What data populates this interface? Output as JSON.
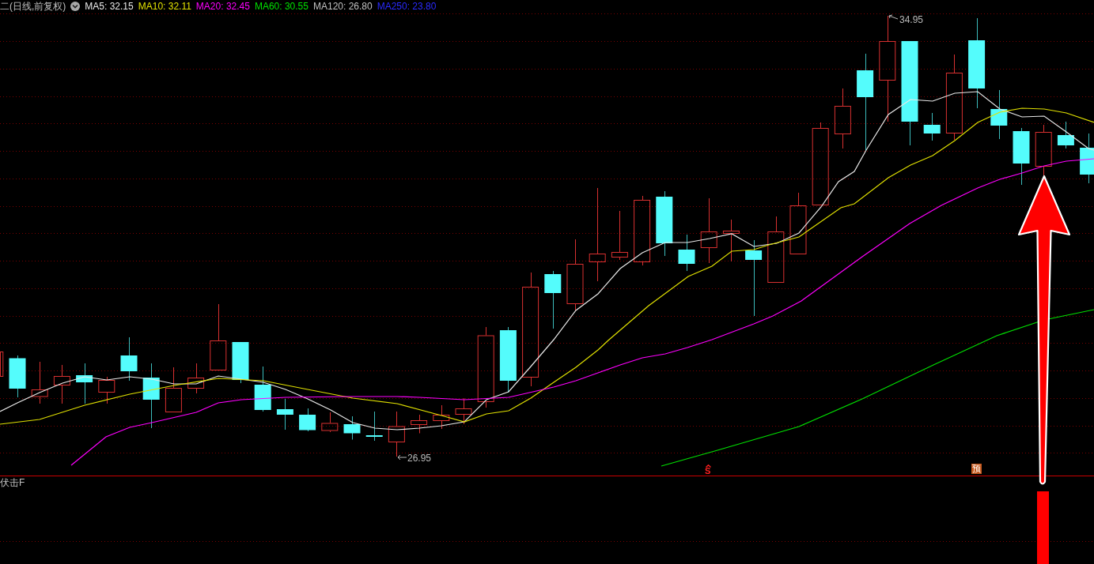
{
  "header": {
    "title": "二(日线,前复权)",
    "indicators": [
      {
        "label": "MA5: 32.15",
        "color": "#e8e8e8"
      },
      {
        "label": "MA10: 32.11",
        "color": "#e0e000"
      },
      {
        "label": "MA20: 32.45",
        "color": "#ff00ff"
      },
      {
        "label": "MA60: 30.55",
        "color": "#00e000"
      },
      {
        "label": "MA120: 26.80",
        "color": "#c0c0c0"
      },
      {
        "label": "MA250: 23.80",
        "color": "#2a2aff"
      }
    ]
  },
  "price_labels": [
    {
      "kind": "high",
      "text": "34.95"
    },
    {
      "kind": "low",
      "text": "26.95"
    }
  ],
  "signals": [
    {
      "kind": "letter",
      "text": "S"
    },
    {
      "kind": "badge",
      "text": "预"
    }
  ],
  "sub_panel": {
    "title": "伏击F"
  }
}
